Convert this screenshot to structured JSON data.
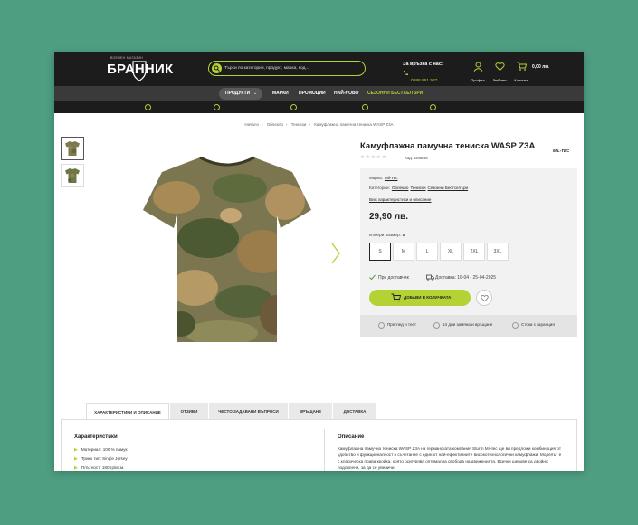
{
  "header": {
    "logo": {
      "tagline": "ВОЕНЕН МАГАЗИН",
      "name": "БРАННИК"
    },
    "search": {
      "placeholder": "Търси по категории, продукт, марка, код..."
    },
    "contact": {
      "label": "За връзка с нас:",
      "phone": "0888 861 527"
    },
    "icons": [
      {
        "label": "Профил",
        "icon": "user-icon"
      },
      {
        "label": "Любими",
        "icon": "heart-icon"
      },
      {
        "label": "Количка",
        "icon": "cart-icon"
      }
    ],
    "cart_total": "0,00 лв."
  },
  "nav": {
    "items": [
      "ПРОДУКТИ",
      "МАРКИ",
      "ПРОМОЦИИ",
      "НАЙ-НОВО",
      "СЕЗОННИ БЕСТСЕЛЪРИ"
    ],
    "accent": "#b3d234"
  },
  "perks": [
    "Преглед и тест",
    "Експресна доставка",
    "Замяна и връщане",
    "Стоки с гаранция",
    "100 000 + доволни клиенти"
  ],
  "breadcrumb": [
    "Начало",
    "Облекло",
    "Тениски",
    "Камуфлажна памучна тениска WASP Z3A"
  ],
  "product": {
    "title": "Камуфлажна памучна тениска WASP Z3A",
    "code_label": "Код: 206585",
    "brand_logo": "MIL-TEC",
    "brand_label": "Марка:",
    "brand": "Mil-Tec",
    "categories_label": "Категории:",
    "categories": [
      "Облекло",
      "Тениски",
      "Сезонни Бестселъри"
    ],
    "specs_link": "Виж характеристики и описание",
    "price": "29,90 лв.",
    "size_label": "Избери размер:",
    "selected_size": "S",
    "sizes": [
      "S",
      "M",
      "L",
      "XL",
      "2XL",
      "3XL"
    ],
    "stock": "При доставчик",
    "delivery": "Доставка: 16-04 - 25-04-2025",
    "add_to_cart": "ДОБАВИ В КОЛИЧКАТА",
    "perks": [
      "Преглед и тест",
      "14 дни замяна и връщане",
      "Стоки с гаранция"
    ]
  },
  "tabs": [
    "ХАРАКТЕРИСТИКИ И ОПИСАНИЕ",
    "ОТЗИВИ",
    "ЧЕСТО ЗАДАВАНИ ВЪПРОСИ",
    "ВРЪЩАНЕ",
    "ДОСТАВКА"
  ],
  "characteristics": {
    "heading": "Характеристики",
    "rows": [
      "Материал: 100 % памук",
      "Трико тип: Single Jersey",
      "Плътност: 180 гр/кв.м."
    ]
  },
  "description": {
    "heading": "Описание",
    "text": "Камуфлажна памучна тениска WASP Z3A на германската компания Sturm Mil-tec ще ви предложи комбинация от удобство и функционалност в съчетание с един от най-ефективните високотехнологични камуфлажи. Моделът е с класическа права кройка, която осигурява оптимална свобода на движенията. Всички шевове са двойно подсилени, за да се увеличи"
  }
}
